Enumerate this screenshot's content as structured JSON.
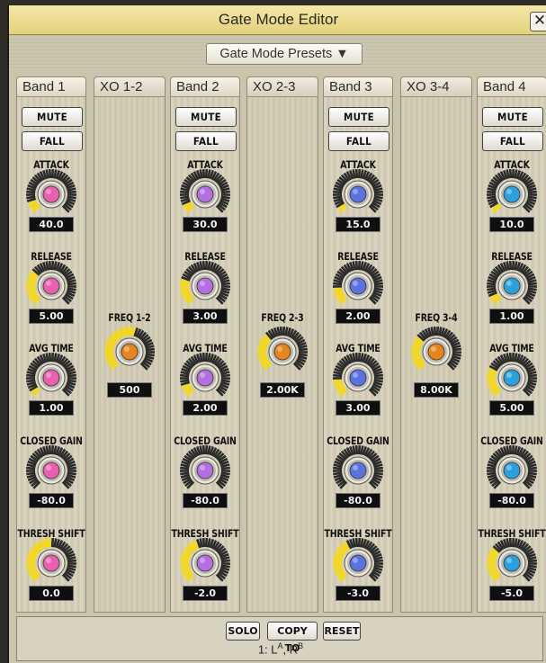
{
  "window": {
    "title": "Gate Mode Editor",
    "close_label": "✕"
  },
  "presets": {
    "label": "Gate Mode Presets ▼"
  },
  "bands": [
    {
      "tab": "Band 1",
      "color": "#ea5fb0",
      "attack": "40.0",
      "release": "5.00",
      "avg_time": "1.00",
      "closed_gain": "-80.0",
      "thresh_shift": "0.0",
      "attack_level": 0.1,
      "release_level": 0.32,
      "avg_level": 0.05,
      "closed_level": 0.0,
      "thresh_level": 0.5
    },
    {
      "tab": "Band 2",
      "color": "#b36ee0",
      "attack": "30.0",
      "release": "3.00",
      "avg_time": "2.00",
      "closed_gain": "-80.0",
      "thresh_shift": "-2.0",
      "attack_level": 0.08,
      "release_level": 0.22,
      "avg_level": 0.1,
      "closed_level": 0.0,
      "thresh_level": 0.42
    },
    {
      "tab": "Band 3",
      "color": "#5c72e0",
      "attack": "15.0",
      "release": "2.00",
      "avg_time": "3.00",
      "closed_gain": "-80.0",
      "thresh_shift": "-3.0",
      "attack_level": 0.05,
      "release_level": 0.15,
      "avg_level": 0.15,
      "closed_level": 0.0,
      "thresh_level": 0.38
    },
    {
      "tab": "Band 4",
      "color": "#2ba0dc",
      "attack": "10.0",
      "release": "1.00",
      "avg_time": "5.00",
      "closed_gain": "-80.0",
      "thresh_shift": "-5.0",
      "attack_level": 0.03,
      "release_level": 0.06,
      "avg_level": 0.25,
      "closed_level": 0.0,
      "thresh_level": 0.3
    }
  ],
  "crossovers": [
    {
      "tab": "XO 1-2",
      "label": "FREQ 1-2",
      "value": "500",
      "level": 0.55
    },
    {
      "tab": "XO 2-3",
      "label": "FREQ 2-3",
      "value": "2.00K",
      "level": 0.35
    },
    {
      "tab": "XO 3-4",
      "label": "FREQ 3-4",
      "value": "8.00K",
      "level": 0.32
    }
  ],
  "labels": {
    "mute": "MUTE",
    "fall": "FALL",
    "attack": "ATTACK",
    "release": "RELEASE",
    "avg_time": "AVG TIME",
    "closed_gain": "CLOSED GAIN",
    "thresh_shift": "THRESH SHIFT"
  },
  "bottom": {
    "solo": "SOLO",
    "copy_to": "COPY TO",
    "reset": "RESET",
    "routing": "1: L",
    "routing_sup1": "A",
    "routing_mid": ", R",
    "routing_sup2": "B"
  },
  "colors": {
    "active_tick": "#f4d81c",
    "xo_knob": "#e6851c",
    "title_bar": "#ebdc8f"
  }
}
